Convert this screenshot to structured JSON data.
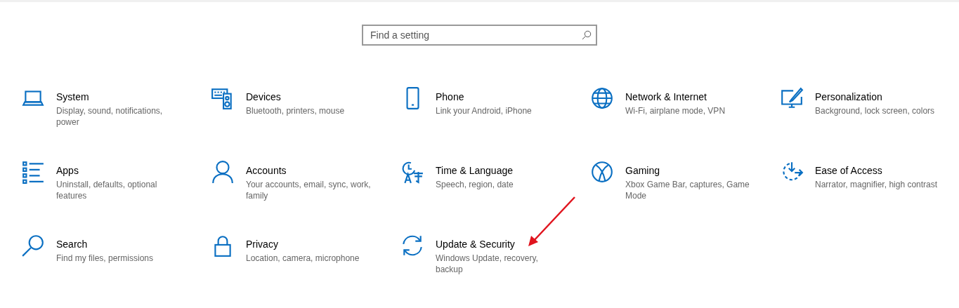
{
  "search": {
    "placeholder": "Find a setting"
  },
  "categories": [
    {
      "title": "System",
      "description": "Display, sound, notifications, power",
      "highlighted": false
    },
    {
      "title": "Devices",
      "description": "Bluetooth, printers, mouse",
      "highlighted": false
    },
    {
      "title": "Phone",
      "description": "Link your Android, iPhone",
      "highlighted": false
    },
    {
      "title": "Network & Internet",
      "description": "Wi-Fi, airplane mode, VPN",
      "highlighted": false
    },
    {
      "title": "Personalization",
      "description": "Background, lock screen, colors",
      "highlighted": false
    },
    {
      "title": "Apps",
      "description": "Uninstall, defaults, optional features",
      "highlighted": false
    },
    {
      "title": "Accounts",
      "description": "Your accounts, email, sync, work, family",
      "highlighted": false
    },
    {
      "title": "Time & Language",
      "description": "Speech, region, date",
      "highlighted": false
    },
    {
      "title": "Gaming",
      "description": "Xbox Game Bar, captures, Game Mode",
      "highlighted": false
    },
    {
      "title": "Ease of Access",
      "description": "Narrator, magnifier, high contrast",
      "highlighted": false
    },
    {
      "title": "Search",
      "description": "Find my files, permissions",
      "highlighted": false
    },
    {
      "title": "Privacy",
      "description": "Location, camera, microphone",
      "highlighted": false
    },
    {
      "title": "Update & Security",
      "description": "Windows Update, recovery, backup",
      "highlighted": true
    }
  ]
}
